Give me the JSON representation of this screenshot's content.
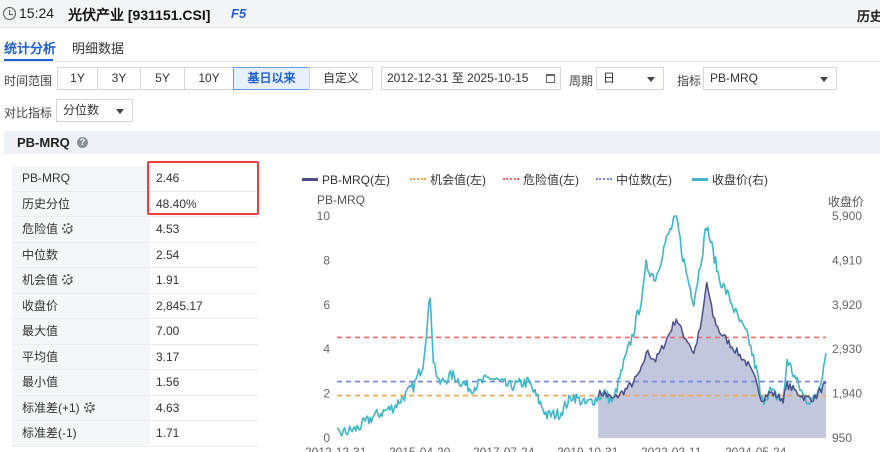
{
  "header": {
    "time": "15:24",
    "title": "光伏产业 [931151.CSI]",
    "shortcut": "F5",
    "right_label": "历史"
  },
  "tabs": [
    {
      "label": "统计分析",
      "active": true
    },
    {
      "label": "明细数据",
      "active": false
    }
  ],
  "filters": {
    "time_range_label": "时间范围",
    "ranges": [
      "1Y",
      "3Y",
      "5Y",
      "10Y",
      "基日以来",
      "自定义"
    ],
    "active_range": "基日以来",
    "date_range": "2012-12-31 至 2025-10-15",
    "period_label": "周期",
    "period_value": "日",
    "indicator_label": "指标",
    "indicator_value": "PB-MRQ",
    "compare_label": "对比指标",
    "compare_value": "分位数"
  },
  "section": {
    "title": "PB-MRQ"
  },
  "stats": [
    {
      "label": "PB-MRQ",
      "value": "2.46",
      "gear": false
    },
    {
      "label": "历史分位",
      "value": "48.40%",
      "gear": false
    },
    {
      "label": "危险值",
      "value": "4.53",
      "gear": true
    },
    {
      "label": "中位数",
      "value": "2.54",
      "gear": false
    },
    {
      "label": "机会值",
      "value": "1.91",
      "gear": true
    },
    {
      "label": "收盘价",
      "value": "2,845.17",
      "gear": false
    },
    {
      "label": "最大值",
      "value": "7.00",
      "gear": false
    },
    {
      "label": "平均值",
      "value": "3.17",
      "gear": false
    },
    {
      "label": "最小值",
      "value": "1.56",
      "gear": false
    },
    {
      "label": "标准差(+1)",
      "value": "4.63",
      "gear": true
    },
    {
      "label": "标准差(-1)",
      "value": "1.71",
      "gear": false
    }
  ],
  "colors": {
    "pb": "#4a4f8c",
    "pb_fill": "#b9bdd8",
    "opportunity": "#f5a54a",
    "danger": "#f06a6a",
    "median": "#6f86e8",
    "close": "#3fb7c9",
    "accent": "#1f5fd1",
    "highlight_box": "#e84040"
  },
  "chart_data": {
    "type": "line",
    "left_axis_title": "PB-MRQ",
    "right_axis_title": "收盘价",
    "left_ticks": [
      "10",
      "8",
      "6",
      "4",
      "2",
      "0"
    ],
    "right_ticks": [
      "5,900",
      "4,910",
      "3,920",
      "2,930",
      "1,940",
      "950"
    ],
    "x_tick_labels": [
      "2012-12-31",
      "2015-04-20",
      "2017-07-24",
      "2019-10-31",
      "2022-02-11",
      "2024-05-24"
    ],
    "ylim_left": [
      0,
      10
    ],
    "ylim_right": [
      950,
      5900
    ],
    "x_range": [
      "2012-12-31",
      "2025-10-15"
    ],
    "legend": [
      "PB-MRQ(左)",
      "机会值(左)",
      "危险值(左)",
      "中位数(左)",
      "收盘价(右)"
    ],
    "reference_lines": {
      "danger": 4.53,
      "median": 2.54,
      "opportunity": 1.91
    },
    "series": [
      {
        "name": "收盘价(右)",
        "x": [
          "2012-12-31",
          "2013-06-30",
          "2014-01-01",
          "2014-06-30",
          "2015-01-01",
          "2015-04-01",
          "2015-06-10",
          "2015-07-10",
          "2015-09-01",
          "2016-01-01",
          "2016-06-30",
          "2017-01-01",
          "2017-06-30",
          "2018-01-01",
          "2018-06-30",
          "2018-10-31",
          "2019-03-01",
          "2019-06-30",
          "2019-10-31",
          "2020-01-01",
          "2020-03-20",
          "2020-07-01",
          "2020-10-01",
          "2021-01-01",
          "2021-02-01",
          "2021-05-01",
          "2021-08-01",
          "2021-11-15",
          "2022-01-15",
          "2022-03-15",
          "2022-05-01",
          "2022-07-15",
          "2022-09-01",
          "2022-11-01",
          "2023-01-01",
          "2023-04-01",
          "2023-07-01",
          "2023-10-01",
          "2024-01-01",
          "2024-02-05",
          "2024-05-01",
          "2024-09-01",
          "2024-10-08",
          "2025-01-01",
          "2025-04-01",
          "2025-07-01",
          "2025-09-01",
          "2025-10-15"
        ],
        "values": [
          1030,
          1150,
          1450,
          1650,
          2100,
          2600,
          4150,
          2700,
          2150,
          2350,
          2050,
          2300,
          2100,
          2200,
          1450,
          1500,
          1900,
          1700,
          1850,
          1950,
          1750,
          2600,
          3300,
          4200,
          4800,
          4500,
          5300,
          5900,
          5000,
          4400,
          4000,
          5000,
          5700,
          5100,
          4500,
          4100,
          3600,
          3200,
          2350,
          1750,
          2000,
          1750,
          2700,
          2250,
          1800,
          1800,
          2300,
          2845
        ]
      },
      {
        "name": "PB-MRQ(左)",
        "x": [
          "2019-10-31",
          "2020-01-01",
          "2020-03-20",
          "2020-07-01",
          "2020-10-01",
          "2021-01-01",
          "2021-02-01",
          "2021-05-01",
          "2021-08-01",
          "2021-11-15",
          "2022-01-15",
          "2022-03-15",
          "2022-05-01",
          "2022-07-15",
          "2022-09-01",
          "2022-11-01",
          "2023-01-01",
          "2023-04-01",
          "2023-07-01",
          "2023-10-01",
          "2024-01-01",
          "2024-02-05",
          "2024-05-01",
          "2024-09-01",
          "2024-10-08",
          "2025-01-01",
          "2025-04-01",
          "2025-07-01",
          "2025-09-01",
          "2025-10-15"
        ],
        "values": [
          2.0,
          2.0,
          1.75,
          2.1,
          2.5,
          3.2,
          3.9,
          3.5,
          4.3,
          5.4,
          4.7,
          4.3,
          3.8,
          5.2,
          7.0,
          5.5,
          4.8,
          4.3,
          3.8,
          3.3,
          2.4,
          1.75,
          2.05,
          1.75,
          2.4,
          2.1,
          1.8,
          1.8,
          2.2,
          2.46
        ]
      }
    ]
  }
}
